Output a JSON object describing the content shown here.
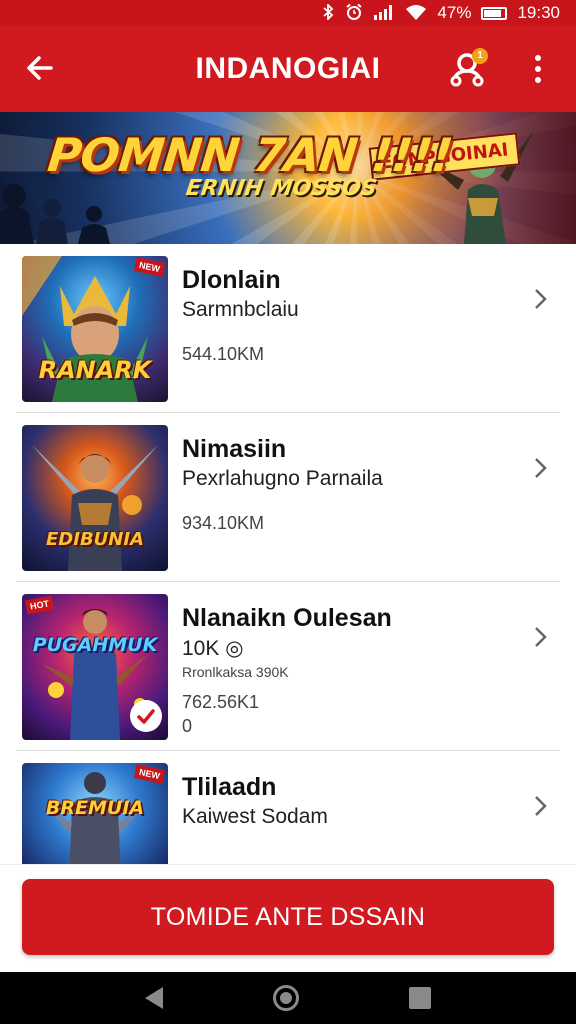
{
  "status_bar": {
    "icons": [
      "bluetooth-icon",
      "alarm-icon",
      "signal-icon",
      "wifi-icon",
      "battery-icon"
    ],
    "battery": "47%",
    "time": "19:30"
  },
  "app_bar": {
    "title": "INDANOGIAI",
    "notification_count": "1",
    "back_icon": "arrow-left-icon",
    "account_icon": "account-icon",
    "more_icon": "more-vertical-icon"
  },
  "banner": {
    "headline": "POMNN 7AN !!!!",
    "subline": "ERNIH MOSSOS",
    "tag": "EONPNOINAI"
  },
  "games": [
    {
      "title": "Dlonlain",
      "subtitle": "Sarmnbclaiu",
      "meta": "544.10KM",
      "meta2": "",
      "thumb_logo": "RANARK",
      "thumb_badge": "NEW"
    },
    {
      "title": "Nimasiin",
      "subtitle": "Pexrlahugno Parnaila",
      "meta": "934.10KM",
      "meta2": "",
      "thumb_logo": "EDIBUNIA",
      "thumb_badge": ""
    },
    {
      "title": "Nlanaikn Oulesan",
      "subtitle": "10K ◎",
      "small_line": "Rronlkaksa 390K",
      "meta": "762.56K1",
      "meta2": "0",
      "thumb_logo": "PUGAHMUK",
      "thumb_badge": "HOT"
    },
    {
      "title": "Tlilaadn",
      "subtitle": "Kaiwest Sodam",
      "meta": "",
      "meta2": "",
      "thumb_logo": "BREMUIA",
      "thumb_badge": "NEW"
    }
  ],
  "primary_action": {
    "label": "TOMIDE ANTE DSSAIN"
  },
  "colors": {
    "brand_red": "#d01a20",
    "status_red": "#c8151b",
    "notif_orange": "#f4a21c"
  }
}
